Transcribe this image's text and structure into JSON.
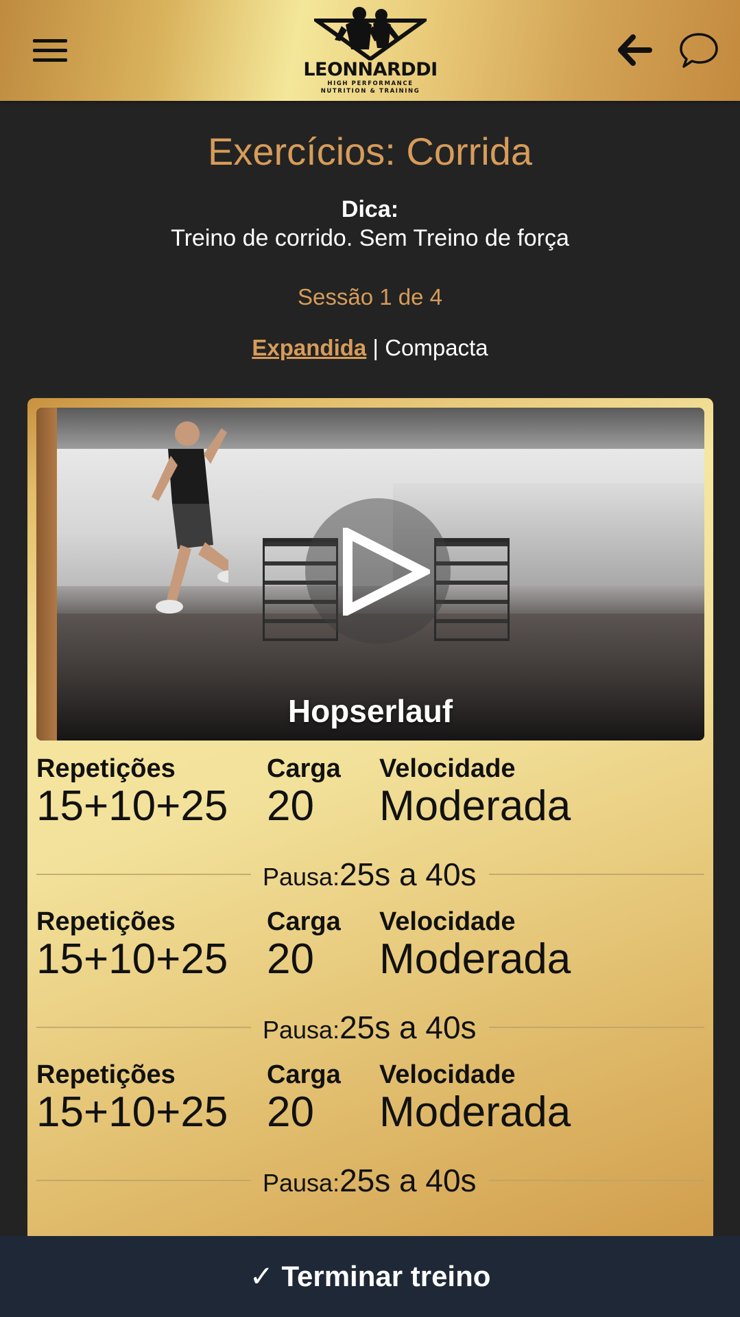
{
  "header": {
    "brand_name": "LEONNARDDI",
    "brand_tagline_1": "HIGH PERFORMANCE",
    "brand_tagline_2": "NUTRITION & TRAINING",
    "icons": [
      "menu-icon",
      "back-arrow-icon",
      "chat-bubble-icon"
    ]
  },
  "page": {
    "title": "Exercícios: Corrida",
    "tip_label": "Dica:",
    "tip_text": "Treino de corrido. Sem Treino de força",
    "session": "Sessão 1 de 4"
  },
  "view_toggle": {
    "expanded": "Expandida",
    "separator": " | ",
    "compact": "Compacta"
  },
  "exercise": {
    "name": "Hopserlauf",
    "sets": [
      {
        "reps_label": "Repetições",
        "reps": "15+10+25",
        "load_label": "Carga",
        "load": "20",
        "speed_label": "Velocidade",
        "speed": "Moderada",
        "pause_label": "Pausa:",
        "pause": "25s a 40s"
      },
      {
        "reps_label": "Repetições",
        "reps": "15+10+25",
        "load_label": "Carga",
        "load": "20",
        "speed_label": "Velocidade",
        "speed": "Moderada",
        "pause_label": "Pausa:",
        "pause": "25s a 40s"
      },
      {
        "reps_label": "Repetições",
        "reps": "15+10+25",
        "load_label": "Carga",
        "load": "20",
        "speed_label": "Velocidade",
        "speed": "Moderada",
        "pause_label": "Pausa:",
        "pause": "25s a 40s"
      }
    ]
  },
  "footer": {
    "finish_label": "✓ Terminar treino"
  },
  "colors": {
    "accent": "#d79c5a",
    "background": "#232323",
    "footer": "#1f2837",
    "gold_light": "#f5e6a0",
    "gold_dark": "#c48a3e"
  }
}
